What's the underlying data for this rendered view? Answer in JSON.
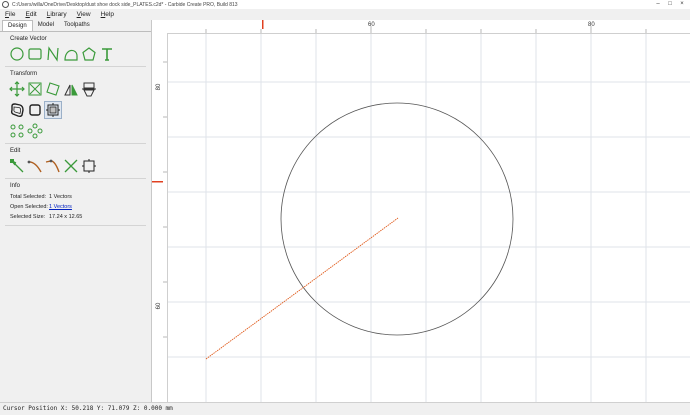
{
  "window": {
    "title": "C:/Users/willa/OneDrive/Desktop/dust shoe dock side_PLATES.c2d* - Carbide Create PRO, Build 813"
  },
  "menubar": {
    "items": [
      {
        "label": "File",
        "mnemonic": "F"
      },
      {
        "label": "Edit",
        "mnemonic": "E"
      },
      {
        "label": "Library",
        "mnemonic": "L"
      },
      {
        "label": "View",
        "mnemonic": "V"
      },
      {
        "label": "Help",
        "mnemonic": "H"
      }
    ]
  },
  "tabs": [
    "Design",
    "Model",
    "Toolpaths"
  ],
  "active_tab": "Design",
  "sections": {
    "create_vector": "Create Vector",
    "transform": "Transform",
    "edit": "Edit",
    "info": "Info"
  },
  "icons": {
    "create_vector": [
      "circle-icon",
      "rectangle-icon",
      "polyline-icon",
      "curve-icon",
      "polygon-icon",
      "text-icon"
    ],
    "transform_row1": [
      "move-icon",
      "scale-icon",
      "rotate-icon",
      "mirror-icon",
      "align-icon"
    ],
    "transform_row2": [
      "offset-icon",
      "boolean-union-icon",
      "boolean-intersect-icon"
    ],
    "transform_row3": [
      "linear-array-icon",
      "circular-array-icon"
    ],
    "edit": [
      "node-edit-icon",
      "curve-edit-icon",
      "smooth-icon",
      "trim-icon",
      "join-icon"
    ]
  },
  "info": {
    "total_selected_label": "Total Selected:",
    "total_selected_value": "1 Vectors",
    "open_selected_label": "Open Selected:",
    "open_selected_value": "1 Vectors",
    "selected_size_label": "Selected Size:",
    "selected_size_value": "17.24 x 12.65"
  },
  "rulers": {
    "top_labels": [
      "60",
      "80"
    ],
    "left_labels": [
      "80",
      "60"
    ]
  },
  "colors": {
    "selection": "#e05a1a",
    "grid": "#dfe3ea",
    "circle": "#555555",
    "link": "#0020c0"
  },
  "status": {
    "cursor": "Cursor Position X: 50.218 Y: 71.079 Z: 0.000 mm"
  }
}
